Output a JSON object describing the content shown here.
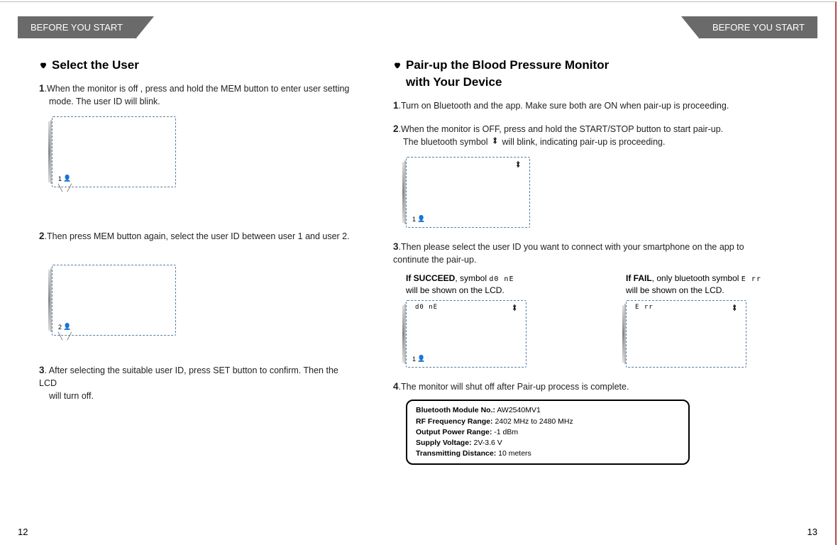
{
  "leftTab": "BEFORE YOU START",
  "rightTab": "BEFORE YOU START",
  "left": {
    "heading": "Select the User",
    "step1_num": "1",
    "step1_a": ".When the monitor is off , press and hold the MEM button to enter user setting",
    "step1_b": "mode. The user ID will blink.",
    "lcd1_user": "1",
    "step2_num": "2",
    "step2": ".Then press MEM button again, select the user ID between user 1 and user 2.",
    "lcd2_user": "2",
    "step3_num": "3",
    "step3_a": ". After selecting the suitable user ID, press SET button to confirm. Then the LCD",
    "step3_b": "will turn off.",
    "page": "12"
  },
  "right": {
    "heading1": "Pair-up the Blood Pressure Monitor",
    "heading2": "with Your Device",
    "step1_num": "1",
    "step1": ".Turn on Bluetooth and the app. Make sure both are ON when pair-up is proceeding.",
    "step2_num": "2",
    "step2_a": ".When the monitor is OFF, press and hold the START/STOP button to start pair-up.",
    "step2_b": "The bluetooth symbol",
    "step2_c": "will blink, indicating pair-up is proceeding.",
    "lcd_user": "1",
    "step3_num": "3",
    "step3_a": ".Then please select the user ID you want to connect with your smartphone on the app to",
    "step3_b": "continute the pair-up.",
    "succeed_a": "If SUCCEED",
    "succeed_b": ", symbol",
    "succeed_sym": "d0 nE",
    "succeed_c": "will be shown on the LCD.",
    "fail_a": "If FAIL",
    "fail_b": ", only bluetooth symbol",
    "fail_sym": "E rr",
    "fail_c": "will be shown on the LCD.",
    "step4_num": "4",
    "step4": ".The monitor will shut off after Pair-up process is complete.",
    "info": {
      "l1a": "Bluetooth Module No.:",
      "l1b": " AW2540MV1",
      "l2a": "RF Frequency Range:",
      "l2b": " 2402 MHz to 2480 MHz",
      "l3a": "Output Power Range:",
      "l3b": " -1 dBm",
      "l4a": "Supply Voltage:",
      "l4b": " 2V-3.6 V",
      "l5a": "Transmitting Distance:",
      "l5b": " 10 meters"
    },
    "page": "13"
  }
}
